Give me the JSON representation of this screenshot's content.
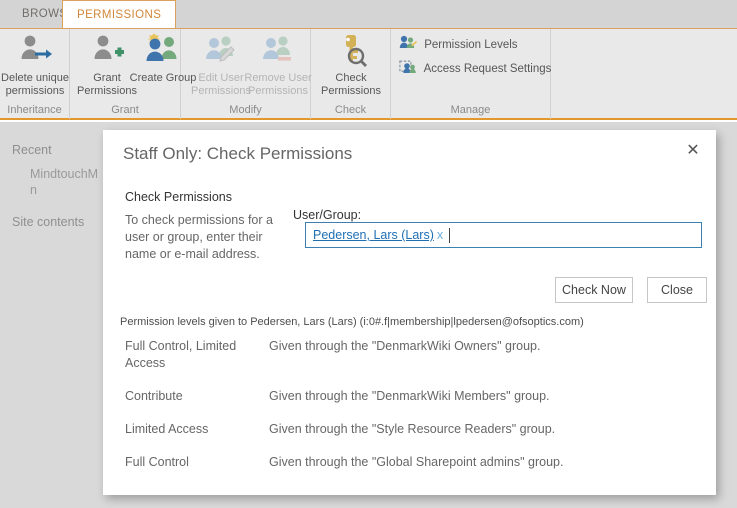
{
  "ribbon": {
    "tabs": [
      {
        "label": "BROWSE",
        "active": false
      },
      {
        "label": "PERMISSIONS",
        "active": true
      }
    ],
    "groups": [
      {
        "name": "Inheritance",
        "label": "Inheritance",
        "buttons": [
          {
            "label": "Delete unique permissions",
            "icon": "delete-unique-permissions-icon",
            "enabled": true
          }
        ]
      },
      {
        "name": "Grant",
        "label": "Grant",
        "buttons": [
          {
            "label": "Grant Permissions",
            "icon": "grant-permissions-icon",
            "enabled": true
          },
          {
            "label": "Create Group",
            "icon": "create-group-icon",
            "enabled": true
          }
        ]
      },
      {
        "name": "Modify",
        "label": "Modify",
        "buttons": [
          {
            "label": "Edit User Permissions",
            "icon": "edit-user-permissions-icon",
            "enabled": false
          },
          {
            "label": "Remove User Permissions",
            "icon": "remove-user-permissions-icon",
            "enabled": false
          }
        ]
      },
      {
        "name": "Check",
        "label": "Check",
        "buttons": [
          {
            "label": "Check Permissions",
            "icon": "check-permissions-icon",
            "enabled": true
          }
        ]
      },
      {
        "name": "Manage",
        "label": "Manage",
        "small_buttons": [
          {
            "label": "Permission Levels",
            "icon": "permission-levels-icon"
          },
          {
            "label": "Access Request Settings",
            "icon": "access-request-settings-icon"
          }
        ]
      }
    ]
  },
  "sidebar": {
    "items": [
      {
        "label": "Recent"
      },
      {
        "label": "MindtouchM n"
      },
      {
        "label": "Site contents"
      }
    ]
  },
  "dialog": {
    "title": "Staff Only: Check Permissions",
    "close_icon": "close-icon",
    "close_glyph": "✕",
    "section_heading": "Check Permissions",
    "description": "To check permissions for a user or group, enter their name or e-mail address.",
    "field_label": "User/Group:",
    "token": {
      "name": "Pedersen, Lars (Lars)",
      "remove_glyph": "x"
    },
    "buttons": {
      "check_now": "Check Now",
      "close": "Close"
    },
    "summary": "Permission levels given to Pedersen, Lars (Lars) (i:0#.f|membership|lpedersen@ofsoptics.com)",
    "permissions": [
      {
        "level": "Full Control, Limited Access",
        "source": "Given through the \"DenmarkWiki Owners\" group."
      },
      {
        "level": "Contribute",
        "source": "Given through the \"DenmarkWiki Members\" group."
      },
      {
        "level": "Limited Access",
        "source": "Given through the \"Style Resource Readers\" group."
      },
      {
        "level": "Full Control",
        "source": "Given through the \"Global Sharepoint admins\" group."
      }
    ]
  },
  "colors": {
    "accent_orange": "#e2982c",
    "tab_active_text": "#d2863a",
    "link_blue": "#1f6fb5",
    "focus_border": "#3c7fb1",
    "ribbon_bg": "#e9e9e9",
    "page_bg": "#d9d9d9"
  }
}
